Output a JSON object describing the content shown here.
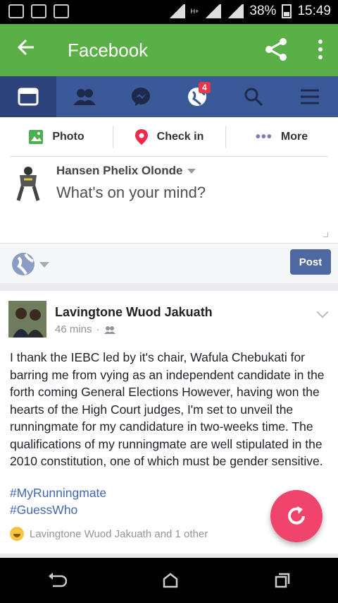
{
  "status_bar": {
    "battery_percent": "38%",
    "time": "15:49",
    "network": "H+"
  },
  "app_bar": {
    "title": "Facebook"
  },
  "fb_nav": {
    "notification_count": "4"
  },
  "composer": {
    "actions": [
      {
        "label": "Photo"
      },
      {
        "label": "Check in"
      },
      {
        "label": "More"
      }
    ],
    "user_name": "Hansen Phelix Olonde",
    "placeholder": "What's on your mind?",
    "post_button": "Post"
  },
  "post": {
    "author": "Lavingtone Wuod Jakuath",
    "time": "46 mins",
    "body": "I thank the IEBC led by it's chair, Wafula Chebukati for barring me from vying as an independent candidate in the forth coming General Elections However, having won the hearts of the High Court judges, I'm set to unveil the runningmate for my candidature in two-weeks time. The qualifications of my runningmate are well stipulated in the 2010 constitution, one of which must be gender sensitive.",
    "hashtags": [
      "#MyRunningmate",
      "#GuessWho"
    ],
    "reactions": "Lavingtone Wuod Jakuath and 1 other"
  },
  "colors": {
    "app_bar": "#5ab047",
    "fb_blue": "#3b5998",
    "fab": "#f0446c"
  }
}
